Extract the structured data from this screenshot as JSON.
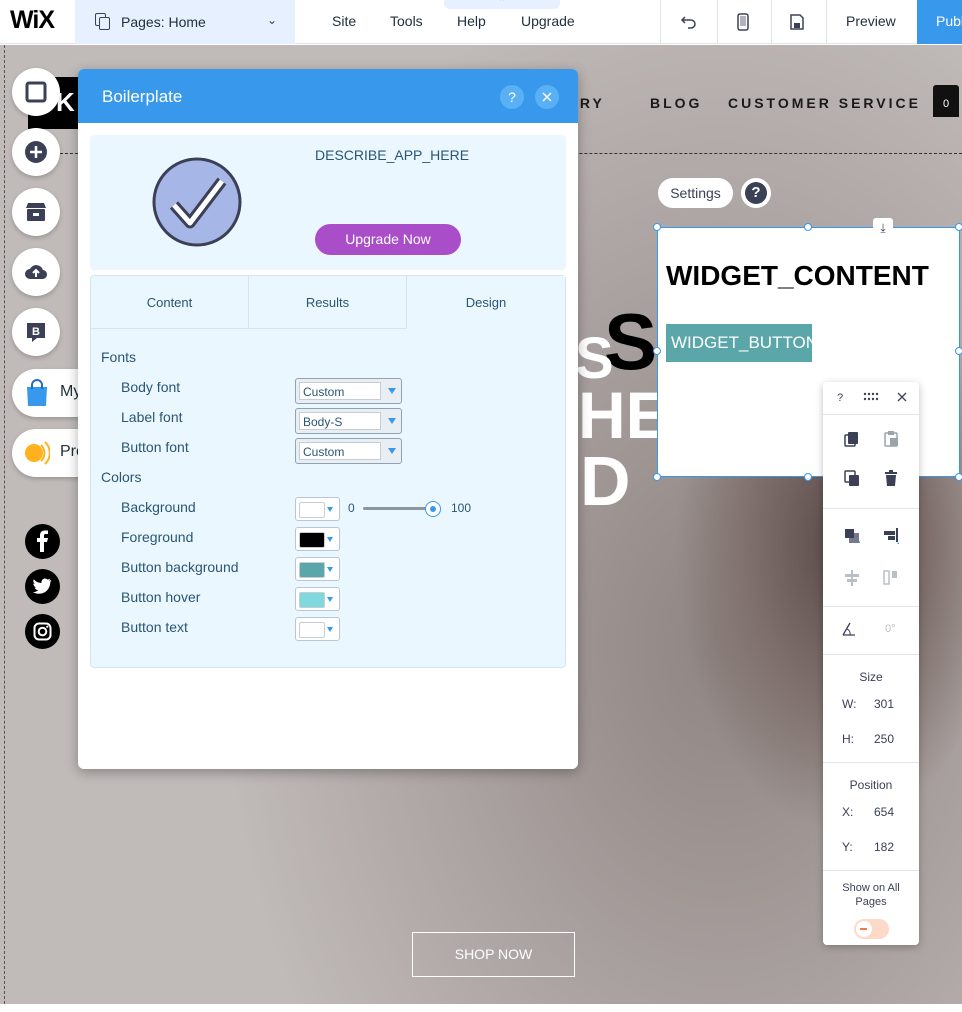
{
  "topbar": {
    "logo": "WiX",
    "page_selector": "Pages: Home",
    "menu": [
      "Site",
      "Tools",
      "Help",
      "Upgrade"
    ],
    "preview": "Preview",
    "publish": "Publish"
  },
  "site": {
    "logo_char": "K",
    "nav": [
      "ORY",
      "BLOG",
      "CUSTOMER SERVICE"
    ],
    "cart_count": "0",
    "hero_black": "S",
    "hero_white": [
      "S",
      "HE",
      "D"
    ],
    "shop_now": "SHOP NOW"
  },
  "rail": {
    "my_label": "My",
    "pro_label": "Pro",
    "blog_badge": "B"
  },
  "widget": {
    "settings": "Settings",
    "help": "?",
    "title": "WIDGET_CONTENT",
    "button": "WIDGET_BUTTON"
  },
  "props": {
    "help": "?",
    "size_label": "Size",
    "w_key": "W:",
    "w_val": "301",
    "h_key": "H:",
    "h_val": "250",
    "position_label": "Position",
    "x_key": "X:",
    "x_val": "654",
    "y_key": "Y:",
    "y_val": "182",
    "rotation": "0°",
    "show_all_pages": "Show on All Pages"
  },
  "panel": {
    "title": "Boilerplate",
    "help": "?",
    "describe": "DESCRIBE_APP_HERE",
    "upgrade": "Upgrade Now",
    "tabs": [
      "Content",
      "Results",
      "Design"
    ],
    "active_tab": "Design",
    "fonts_title": "Fonts",
    "fonts": [
      {
        "label": "Body font",
        "value": "Custom"
      },
      {
        "label": "Label font",
        "value": "Body-S"
      },
      {
        "label": "Button font",
        "value": "Custom"
      }
    ],
    "colors_title": "Colors",
    "colors": [
      {
        "label": "Background",
        "color": "#ffffff"
      },
      {
        "label": "Foreground",
        "color": "#000000"
      },
      {
        "label": "Button background",
        "color": "#5ba6a8"
      },
      {
        "label": "Button hover",
        "color": "#7fd9dc"
      },
      {
        "label": "Button text",
        "color": "#ffffff"
      }
    ],
    "opacity_min": "0",
    "opacity_max": "100",
    "opacity_value": 100
  },
  "colors": {
    "accent": "#3899ec",
    "upgrade": "#aa4dc8",
    "panel_bg": "#eaf7ff"
  }
}
